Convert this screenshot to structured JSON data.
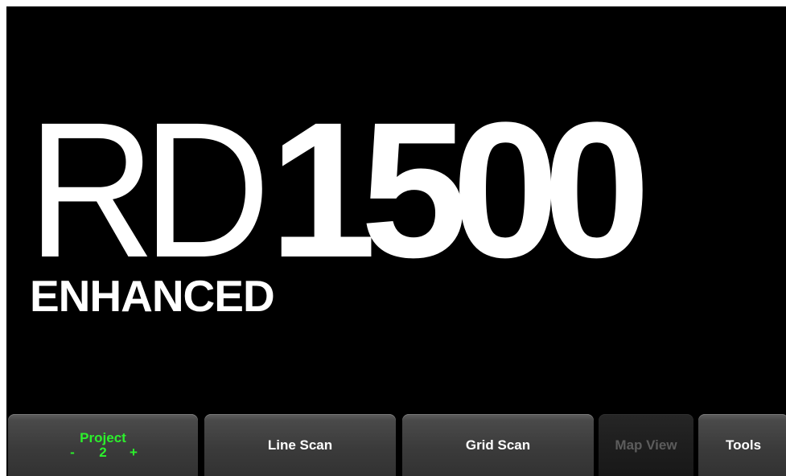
{
  "logo": {
    "prefix": "RD",
    "number": "1500",
    "subtitle": "ENHANCED"
  },
  "softkeys": {
    "project": {
      "label": "Project",
      "minus": "-",
      "value": "2",
      "plus": "+"
    },
    "line_scan": "Line Scan",
    "grid_scan": "Grid Scan",
    "map_view": "Map View",
    "tools": "Tools"
  },
  "colors": {
    "background": "#000000",
    "text": "#ffffff",
    "project_accent": "#2cf02c",
    "disabled_text": "#5c5c5c"
  }
}
